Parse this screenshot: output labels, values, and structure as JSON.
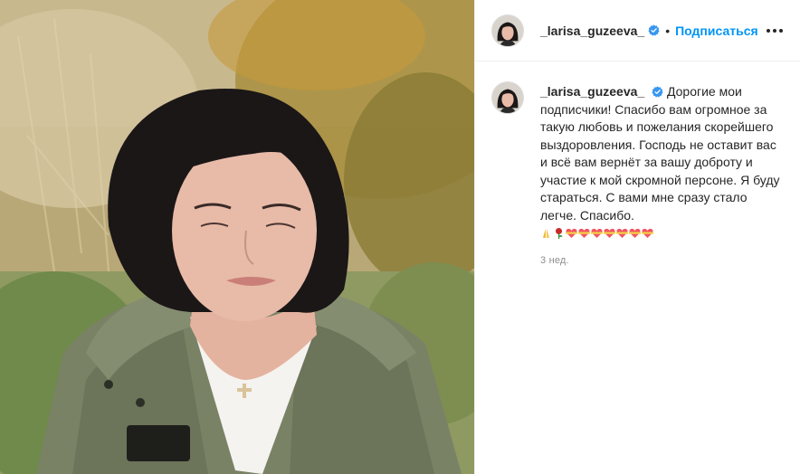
{
  "post": {
    "username": "_larisa_guzeeva_",
    "verified": true,
    "follow_label": "Подписаться",
    "separator": "•",
    "more_label": "More options"
  },
  "caption": {
    "username": "_larisa_guzeeva_",
    "text": "Дорогие мои подписчики! Спасибо вам огромное за такую любовь и пожелания скорейшего выздоровления. Господь не оставит вас и всё вам вернёт за вашу доброту и участие к мой скромной персоне. Я буду стараться. С вами мне сразу стало легче. Спасибо.",
    "emojis": [
      "folded-hands",
      "rose",
      "heart-ribbon",
      "heart-ribbon",
      "heart-ribbon",
      "heart-ribbon",
      "heart-ribbon",
      "heart-ribbon",
      "heart-ribbon"
    ]
  },
  "timestamp": "3 нед.",
  "colors": {
    "accent": "#0095f6",
    "text": "#262626",
    "muted": "#8e8e8e",
    "border": "#efefef"
  },
  "photo": {
    "description_icon": "post-photo"
  }
}
